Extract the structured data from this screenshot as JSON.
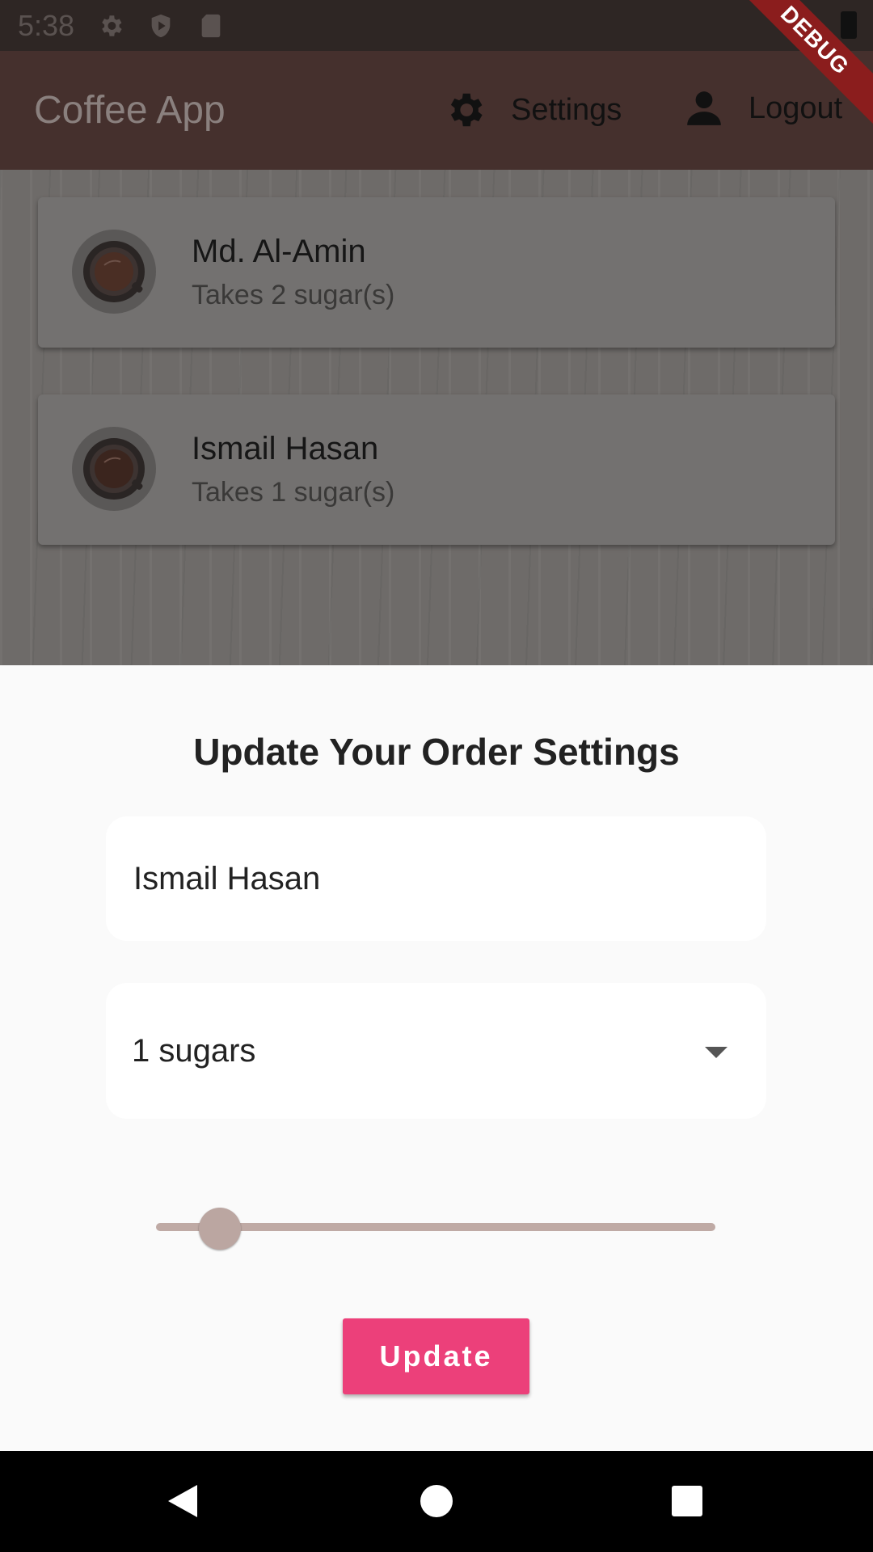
{
  "status_bar": {
    "time": "5:38",
    "debug_banner": "DEBUG"
  },
  "app_bar": {
    "title": "Coffee App",
    "settings_label": "Settings",
    "logout_label": "Logout"
  },
  "brews": [
    {
      "name": "Md. Al-Amin",
      "subtitle": "Takes 2 sugar(s)"
    },
    {
      "name": "Ismail Hasan",
      "subtitle": "Takes 1 sugar(s)"
    }
  ],
  "sheet": {
    "title": "Update Your Order Settings",
    "name_value": "Ismail Hasan",
    "sugars_value": "1 sugars",
    "strength_slider": {
      "value": 100,
      "min": 100,
      "max": 900
    },
    "update_label": "Update"
  },
  "colors": {
    "app_bar": "#45302d",
    "accent_button": "#ec407a",
    "slider": "#bfaaa5"
  }
}
